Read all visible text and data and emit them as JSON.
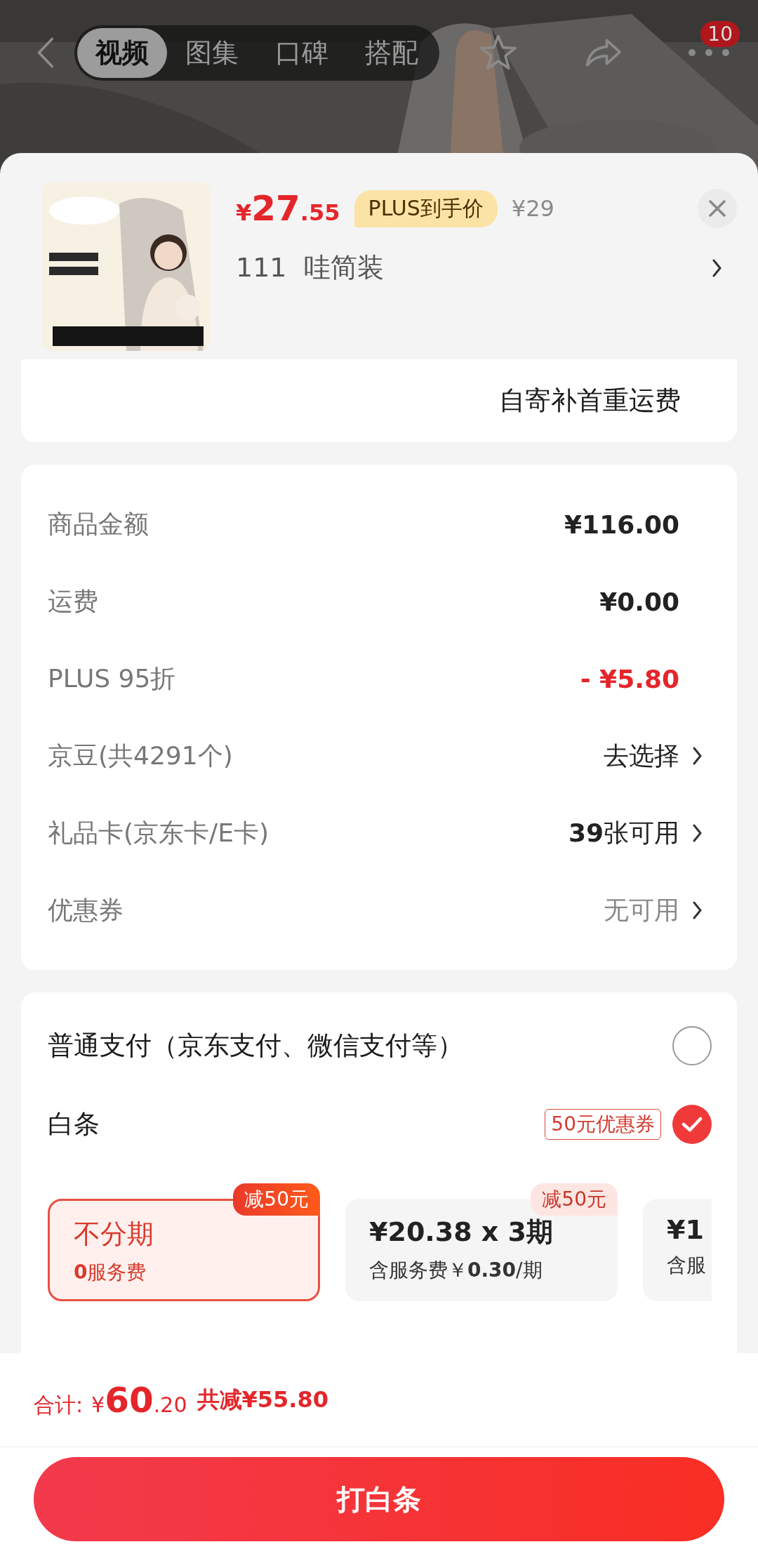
{
  "top_bar": {
    "tabs": [
      {
        "label": "视频",
        "selected": true
      },
      {
        "label": "图集",
        "selected": false
      },
      {
        "label": "口碑",
        "selected": false
      },
      {
        "label": "搭配",
        "selected": false
      }
    ],
    "badge": "10"
  },
  "product": {
    "kind": "picture",
    "currency": "¥",
    "price_int": "27",
    "price_dec": ".55",
    "plus_tag": "PLUS到手价",
    "original_price": "¥29",
    "variant": "111  哇简装"
  },
  "shipping_note": "自寄补首重运费",
  "summary": [
    {
      "label": "商品金额",
      "value": "¥116.00",
      "kind": "strong",
      "arrow": false
    },
    {
      "label": "运费",
      "value": "¥0.00",
      "kind": "strong",
      "arrow": false
    },
    {
      "label": "PLUS 95折",
      "value": "- ¥5.80",
      "kind": "discount",
      "arrow": false
    },
    {
      "label": "京豆(共4291个)",
      "value": "去选择",
      "kind": "normal",
      "arrow": true
    },
    {
      "label": "礼品卡(京东卡/E卡)",
      "value": "**39**张可用",
      "kind": "normal",
      "arrow": true
    },
    {
      "label": "优惠券",
      "value": "无可用",
      "kind": "muted",
      "arrow": true
    }
  ],
  "payment": {
    "options": [
      {
        "label": "普通支付（京东支付、微信支付等）",
        "selected": false
      },
      {
        "label": "白条",
        "coupon": "50元优惠券",
        "selected": true
      }
    ],
    "plans": [
      {
        "title": "不分期",
        "subtitle": "**0**服务费",
        "tag": "减50元",
        "selected": true
      },
      {
        "title": "¥20.38 x 3期",
        "subtitle": "含服务费￥**0.30**/期",
        "tag": "减50元",
        "selected": false
      },
      {
        "title": "¥1",
        "subtitle": "含服",
        "selected": false
      }
    ]
  },
  "footer": {
    "total_label": "合计:",
    "currency": "¥",
    "total_int": "60",
    "total_dec": ".20",
    "savings": "共减¥55.80",
    "submit": "打白条"
  }
}
